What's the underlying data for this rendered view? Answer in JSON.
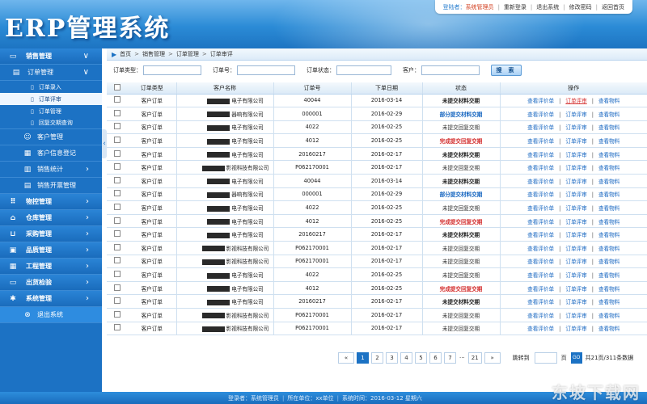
{
  "header": {
    "title": "ERP管理系统",
    "welcome_label": "登陆者：",
    "user_role": "系统管理员",
    "links": [
      "重新登录",
      "退出系统",
      "修改密码",
      "返回首页"
    ]
  },
  "sidebar": {
    "sections": [
      {
        "label": "销售管理",
        "icon": "monitor-icon"
      },
      {
        "label": "物控管理",
        "icon": "grid-icon"
      },
      {
        "label": "仓库管理",
        "icon": "warehouse-icon"
      },
      {
        "label": "采购管理",
        "icon": "cart-icon"
      },
      {
        "label": "品质管理",
        "icon": "quality-icon"
      },
      {
        "label": "工程管理",
        "icon": "engineering-icon"
      },
      {
        "label": "出货检验",
        "icon": "screen-icon"
      },
      {
        "label": "系统管理",
        "icon": "gear-icon"
      }
    ],
    "order_group": {
      "label": "订单管理"
    },
    "order_items": [
      {
        "label": "订单录入"
      },
      {
        "label": "订单评审"
      },
      {
        "label": "订单管理"
      },
      {
        "label": "回复交期查询"
      }
    ],
    "customer_items": [
      {
        "label": "客户管理"
      },
      {
        "label": "客户信息登记"
      }
    ],
    "sales_stats": {
      "label": "销售统计"
    },
    "sales_invoice": {
      "label": "销售开票管理"
    },
    "logout": {
      "label": "退出系统"
    }
  },
  "breadcrumb": [
    "首页",
    "销售管理",
    "订单管理",
    "订单审评"
  ],
  "search": {
    "type_label": "订单类型：",
    "number_label": "订单号：",
    "status_label": "订单状态：",
    "customer_label": "客户：",
    "button": "搜 索"
  },
  "table": {
    "columns": [
      "订单类型",
      "客户名称",
      "订单号",
      "下单日期",
      "状态",
      "操作"
    ],
    "ops": [
      "查看评价单",
      "订单评审",
      "查看物料"
    ],
    "rows": [
      {
        "type": "客户订单",
        "customer": "电子有限公司",
        "number": "40044",
        "date": "2016-03-14",
        "status": "未提交材料交期",
        "status_style": "default",
        "op2": "订单评审",
        "op2_red": true
      },
      {
        "type": "客户订单",
        "customer": "器响有限公司",
        "number": "000001",
        "date": "2016-02-29",
        "status": "部分提交材料交期",
        "status_style": "blue",
        "op2": "订单评审",
        "op2_red": false
      },
      {
        "type": "客户订单",
        "customer": "电子有限公司",
        "number": "4022",
        "date": "2016-02-25",
        "status": "未提交回复交期",
        "status_style": "gray",
        "op2": "订单评审",
        "op2_red": false
      },
      {
        "type": "客户订单",
        "customer": "电子有限公司",
        "number": "4012",
        "date": "2016-02-25",
        "status": "完成提交回复交期",
        "status_style": "red",
        "op2": "订单评审",
        "op2_red": false
      },
      {
        "type": "客户订单",
        "customer": "电子有限公司",
        "number": "20160217",
        "date": "2016-02-17",
        "status": "未提交材料交期",
        "status_style": "default",
        "op2": "订单评审",
        "op2_red": false
      },
      {
        "type": "客户订单",
        "customer": "影视科技有限公司",
        "number": "P062170001",
        "date": "2016-02-17",
        "status": "未提交回复交期",
        "status_style": "gray",
        "op2": "订单评审",
        "op2_red": false
      },
      {
        "type": "客户订单",
        "customer": "电子有限公司",
        "number": "40044",
        "date": "2016-03-14",
        "status": "未提交材料交期",
        "status_style": "default",
        "op2": "订单评审",
        "op2_red": false
      },
      {
        "type": "客户订单",
        "customer": "器响有限公司",
        "number": "000001",
        "date": "2016-02-29",
        "status": "部分提交材料交期",
        "status_style": "blue",
        "op2": "订单评审",
        "op2_red": false
      },
      {
        "type": "客户订单",
        "customer": "电子有限公司",
        "number": "4022",
        "date": "2016-02-25",
        "status": "未提交回复交期",
        "status_style": "gray",
        "op2": "订单评审",
        "op2_red": false
      },
      {
        "type": "客户订单",
        "customer": "电子有限公司",
        "number": "4012",
        "date": "2016-02-25",
        "status": "完成提交回复交期",
        "status_style": "red",
        "op2": "订单评审",
        "op2_red": false
      },
      {
        "type": "客户订单",
        "customer": "电子有限公司",
        "number": "20160217",
        "date": "2016-02-17",
        "status": "未提交材料交期",
        "status_style": "default",
        "op2": "订单评审",
        "op2_red": false
      },
      {
        "type": "客户订单",
        "customer": "影视科技有限公司",
        "number": "P062170001",
        "date": "2016-02-17",
        "status": "未提交回复交期",
        "status_style": "gray",
        "op2": "订单评审",
        "op2_red": false
      },
      {
        "type": "客户订单",
        "customer": "影视科技有限公司",
        "number": "P062170001",
        "date": "2016-02-17",
        "status": "未提交回复交期",
        "status_style": "gray",
        "op2": "订单评审",
        "op2_red": false
      },
      {
        "type": "客户订单",
        "customer": "电子有限公司",
        "number": "4022",
        "date": "2016-02-25",
        "status": "未提交回复交期",
        "status_style": "gray",
        "op2": "订单评审",
        "op2_red": false
      },
      {
        "type": "客户订单",
        "customer": "电子有限公司",
        "number": "4012",
        "date": "2016-02-25",
        "status": "完成提交回复交期",
        "status_style": "red",
        "op2": "订单评审",
        "op2_red": false
      },
      {
        "type": "客户订单",
        "customer": "电子有限公司",
        "number": "20160217",
        "date": "2016-02-17",
        "status": "未提交材料交期",
        "status_style": "default",
        "op2": "订单评审",
        "op2_red": false
      },
      {
        "type": "客户订单",
        "customer": "影视科技有限公司",
        "number": "P062170001",
        "date": "2016-02-17",
        "status": "未提交回复交期",
        "status_style": "gray",
        "op2": "订单评审",
        "op2_red": false
      },
      {
        "type": "客户订单",
        "customer": "影视科技有限公司",
        "number": "P062170001",
        "date": "2016-02-17",
        "status": "未提交回复交期",
        "status_style": "gray",
        "op2": "订单评审",
        "op2_red": false
      }
    ]
  },
  "pager": {
    "prev": "«",
    "pages": [
      "1",
      "2",
      "3",
      "4",
      "5",
      "6",
      "7"
    ],
    "ellipsis": "···",
    "last": "21",
    "next": "»",
    "current": "1",
    "jump_label": "跳转到",
    "page_suffix": "页",
    "go": "GO",
    "summary": "共21页/311条数据"
  },
  "footer": {
    "login_user": "登录者：系统管理员",
    "unit": "所在单位：xx单位",
    "time": "系统时间：2016-03-12 星期六"
  },
  "watermark": "东坡下载网",
  "colors": {
    "primary": "#1c72c4",
    "header": "#2b8bd6",
    "red": "#d32f2f",
    "blue": "#1565c0"
  }
}
